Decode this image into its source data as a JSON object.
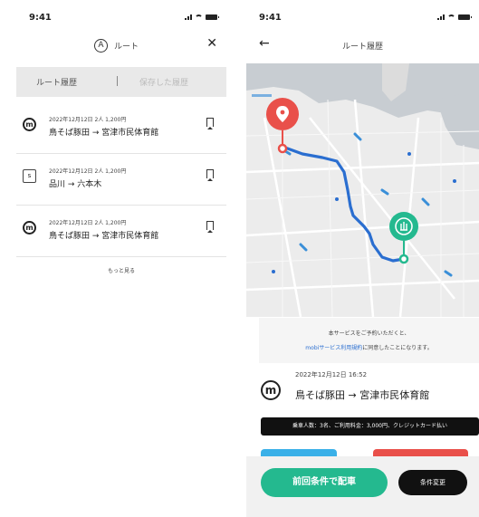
{
  "left": {
    "time": "9:41",
    "header": {
      "logo": "A",
      "title": "ルート"
    },
    "tabs": {
      "active": "ルート履歴",
      "inactive": "保存した履歴"
    },
    "routes": [
      {
        "icon": "m",
        "meta": "2022年12月12日 2人 1,200円",
        "path": "鳥そば豚田 → 宮津市民体育館"
      },
      {
        "icon": "s",
        "meta": "2022年12月12日 2人 1,200円",
        "path": "品川 → 六本木"
      },
      {
        "icon": "m",
        "meta": "2022年12月12日 2人 1,200円",
        "path": "鳥そば豚田 → 宮津市民体育館"
      }
    ],
    "more": "もっと見る"
  },
  "right": {
    "time": "9:41",
    "title": "ルート履歴",
    "note": {
      "line1": "本サービスをご予約いただくと、",
      "link": "mobiサービス利用規約",
      "line2_rest": "に同意したことになります。"
    },
    "route": {
      "icon": "m",
      "meta": "2022年12月12日 16:52",
      "path": "鳥そば豚田 → 宮津市民体育館"
    },
    "summary": "乗車人数：3名、ご利用料金：3,000円、クレジットカード払い",
    "buttons": {
      "primary": "前回条件で配車",
      "secondary": "条件変更"
    }
  },
  "colors": {
    "green": "#24b98f",
    "red": "#e9504a",
    "route_blue": "#2a6ed0",
    "water": "#c8cdd2",
    "land": "#ececec"
  }
}
